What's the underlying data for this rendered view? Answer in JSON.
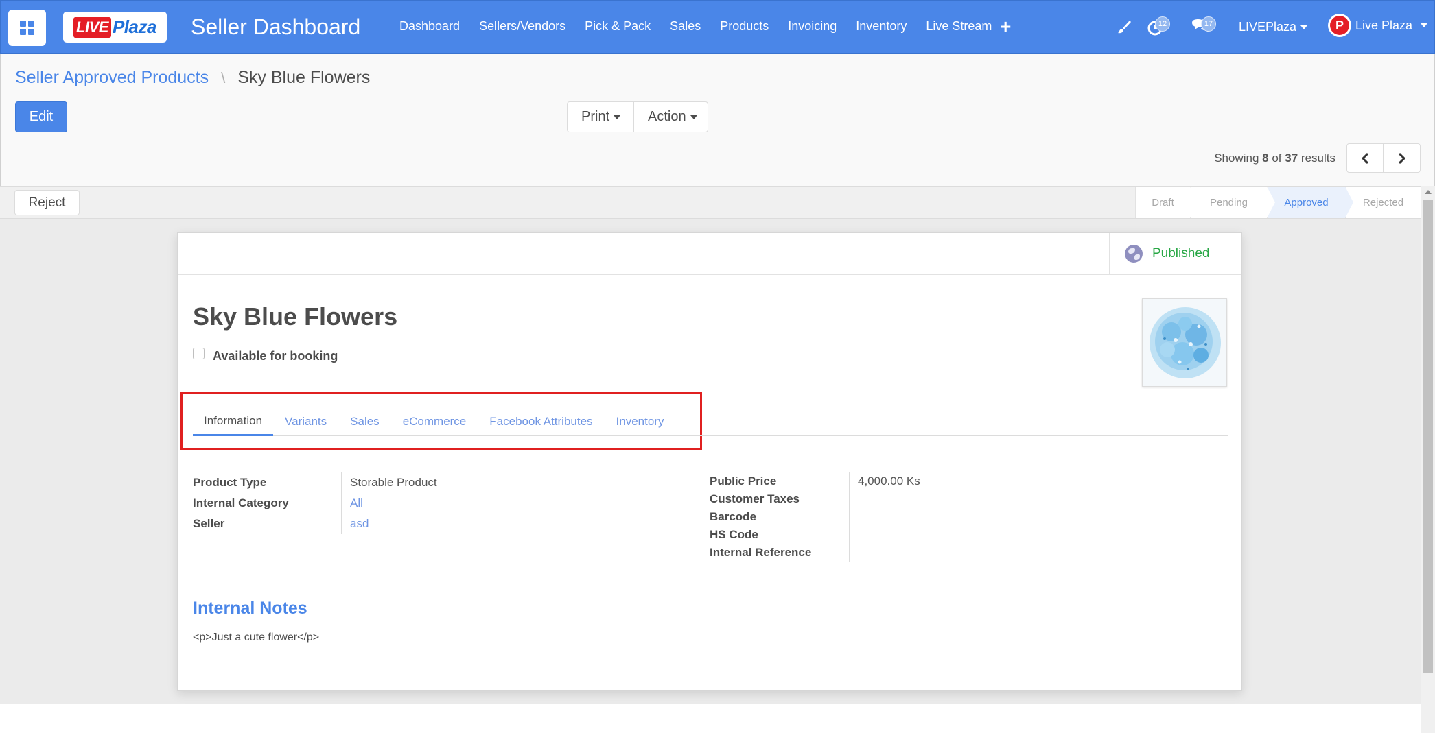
{
  "navbar": {
    "logo_live": "LIVE",
    "logo_plaza": "Plaza",
    "title": "Seller Dashboard",
    "menu": [
      "Dashboard",
      "Sellers/Vendors",
      "Pick & Pack",
      "Sales",
      "Products",
      "Invoicing",
      "Inventory",
      "Live Stream"
    ],
    "activity_count": "12",
    "message_count": "17",
    "company": "LIVEPlaza",
    "user": "Live Plaza",
    "avatar_letter": "P"
  },
  "breadcrumb": {
    "parent": "Seller Approved Products",
    "separator": "\\",
    "current": "Sky Blue Flowers"
  },
  "buttons": {
    "edit": "Edit",
    "print": "Print",
    "action": "Action",
    "reject": "Reject"
  },
  "pager": {
    "prefix": "Showing",
    "current": "8",
    "of": "of",
    "total": "37",
    "suffix": "results"
  },
  "stages": [
    {
      "label": "Draft",
      "active": false
    },
    {
      "label": "Pending",
      "active": false
    },
    {
      "label": "Approved",
      "active": true
    },
    {
      "label": "Rejected",
      "active": false
    }
  ],
  "form": {
    "published": "Published",
    "name": "Sky Blue Flowers",
    "booking_label": "Available for booking",
    "tabs": [
      "Information",
      "Variants",
      "Sales",
      "eCommerce",
      "Facebook Attributes",
      "Inventory"
    ],
    "left_fields": [
      {
        "label": "Product Type",
        "value": "Storable Product",
        "link": false
      },
      {
        "label": "Internal Category",
        "value": "All",
        "link": true
      },
      {
        "label": "Seller",
        "value": "asd",
        "link": true
      }
    ],
    "right_fields": [
      {
        "label": "Public Price",
        "value": "4,000.00 Ks"
      },
      {
        "label": "Customer Taxes",
        "value": ""
      },
      {
        "label": "Barcode",
        "value": ""
      },
      {
        "label": "HS Code",
        "value": ""
      },
      {
        "label": "Internal Reference",
        "value": ""
      }
    ],
    "notes_title": "Internal Notes",
    "notes_body": "<p>Just a cute flower</p>"
  },
  "colors": {
    "primary": "#4a86e8",
    "published": "#28a745",
    "highlight": "#e02020"
  }
}
